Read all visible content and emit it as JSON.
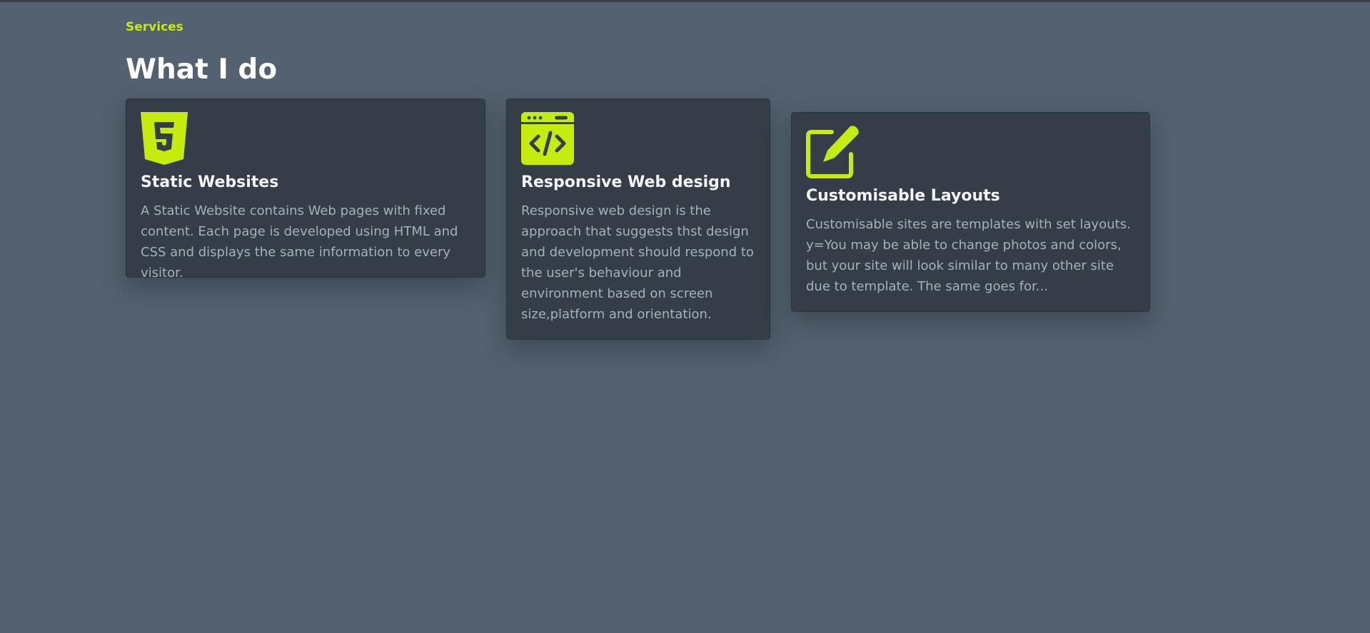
{
  "section": {
    "label": "Services",
    "title": "What I do"
  },
  "accent_color": "#c5ec0c",
  "cards": [
    {
      "icon": "html5-icon",
      "title": "Static Websites",
      "description": "A Static Website contains Web pages with fixed content. Each page is developed using HTML and CSS and displays the same information to every visitor."
    },
    {
      "icon": "code-browser-icon",
      "title": "Responsive Web design",
      "description": "Responsive web design is the approach that suggests thst design and development should respond to the user's behaviour and environment based on screen size,platform and orientation."
    },
    {
      "icon": "edit-pen-icon",
      "title": "Customisable Layouts",
      "description": "Customisable sites are templates with set layouts. y=You may be able to change photos and colors, but your site will look similar to many other site due to template. The same goes for..."
    }
  ]
}
